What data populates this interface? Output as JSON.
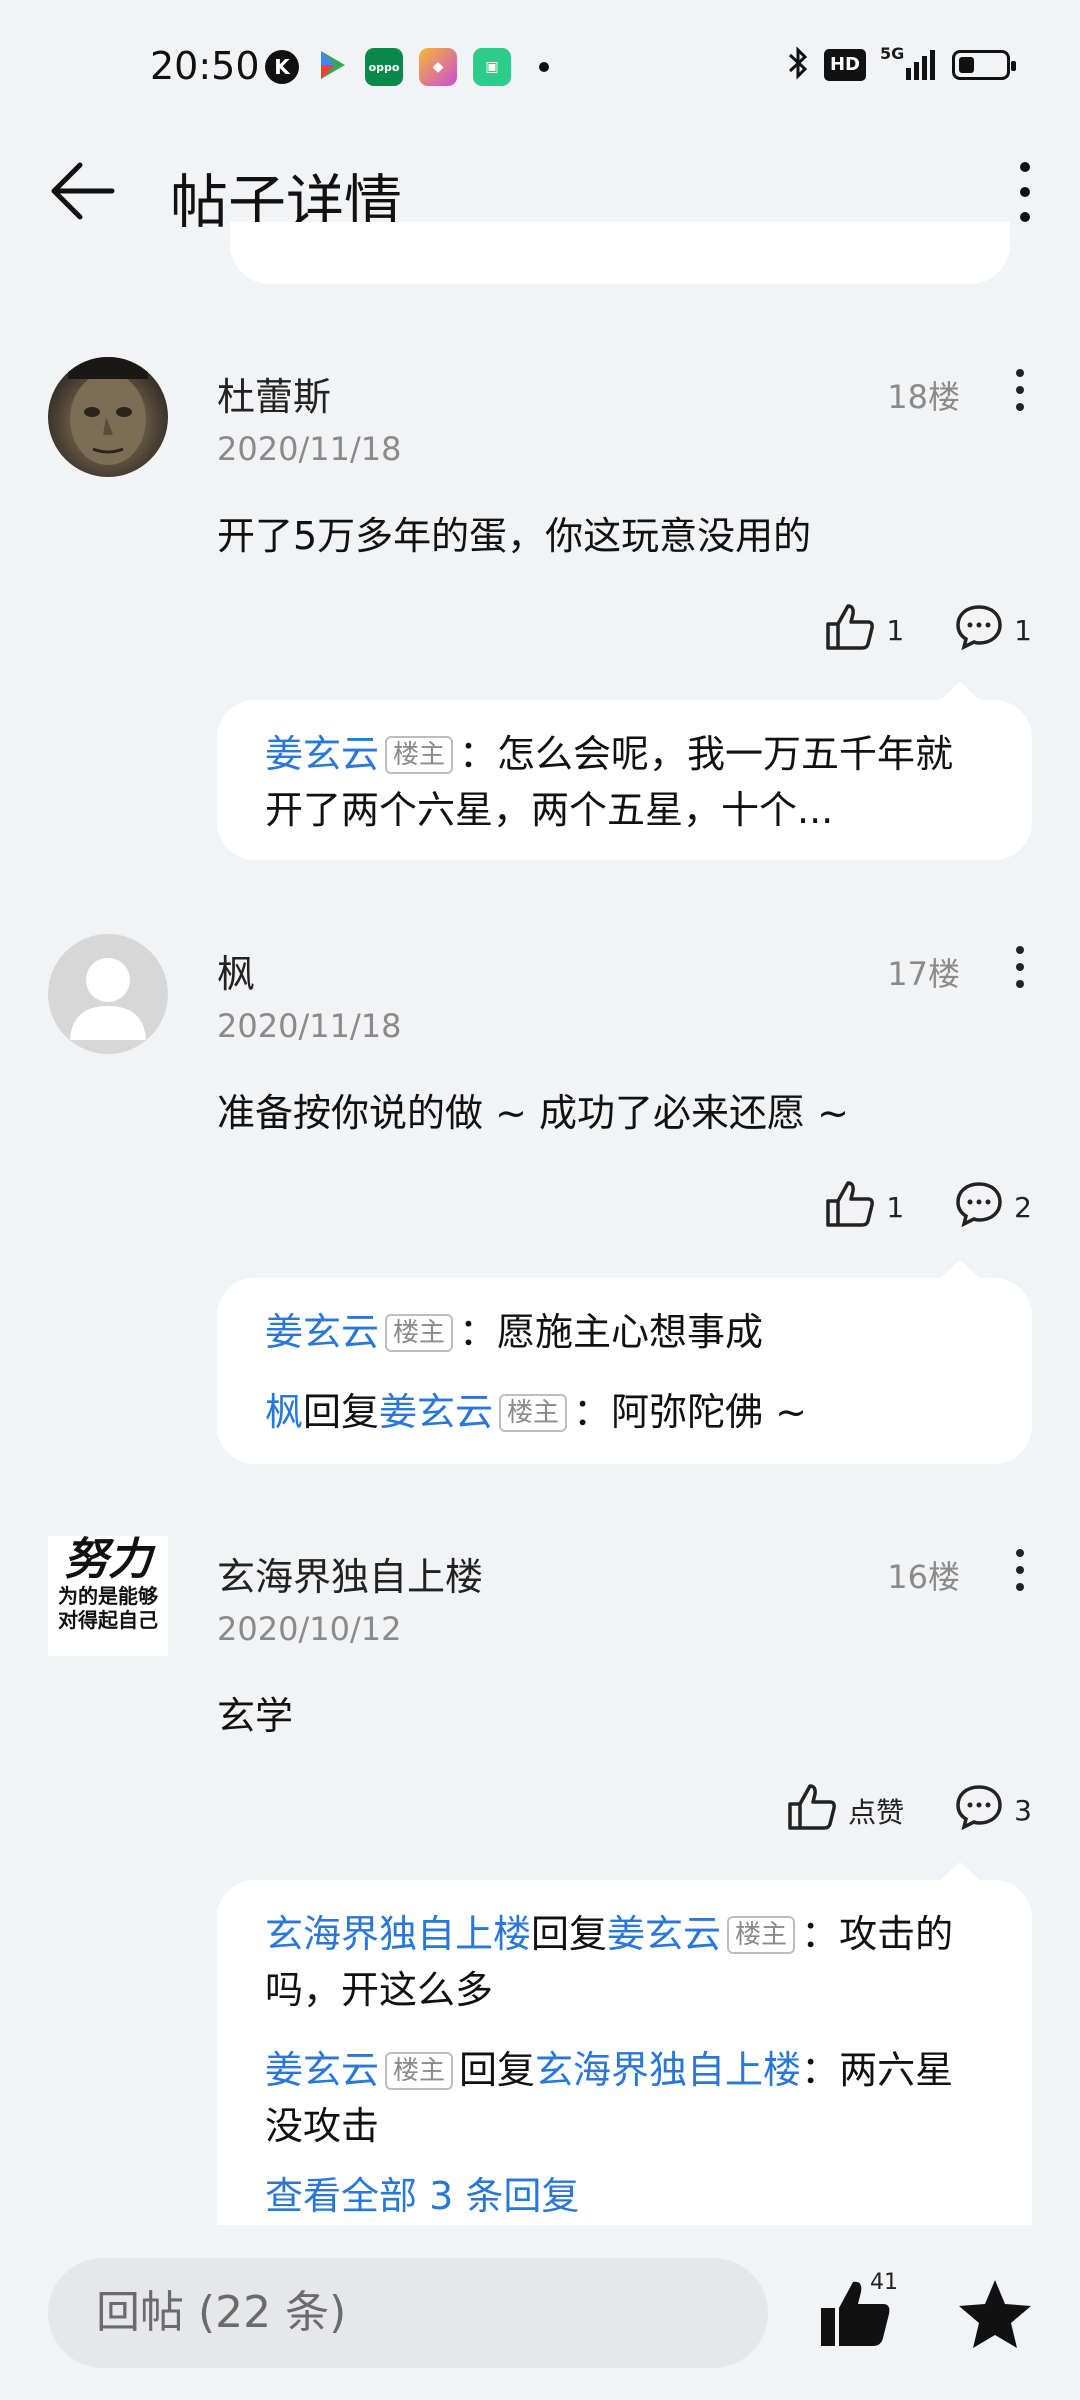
{
  "status_bar": {
    "time": "20:50",
    "network": "5G",
    "hd": "HD",
    "battery_level": 0.35
  },
  "header": {
    "title": "帖子详情"
  },
  "posts": [
    {
      "username": "杜蕾斯",
      "date": "2020/11/18",
      "floor": "18楼",
      "content": "开了5万多年的蛋，你这玩意没用的",
      "likes": "1",
      "comments": "1",
      "replies": [
        {
          "from": "姜玄云",
          "badge": "楼主",
          "sep": "：",
          "text": "怎么会呢，我一万五千年就开了两个六星，两个五星，十个..."
        }
      ]
    },
    {
      "username": "枫",
      "date": "2020/11/18",
      "floor": "17楼",
      "content": "准备按你说的做 ~ 成功了必来还愿 ~",
      "likes": "1",
      "comments": "2",
      "replies": [
        {
          "from": "姜玄云",
          "badge": "楼主",
          "sep": "：",
          "text": "愿施主心想事成"
        },
        {
          "from": "枫",
          "reply_word": "回复",
          "to": "姜玄云",
          "badge": "楼主",
          "sep": "：",
          "text": "阿弥陀佛 ~"
        }
      ]
    },
    {
      "username": "玄海界独自上楼",
      "date": "2020/10/12",
      "floor": "16楼",
      "content": "玄学",
      "likes": "点赞",
      "comments": "3",
      "avatar_text": [
        "努力",
        "为的是能够",
        "对得起自己"
      ],
      "replies": [
        {
          "from": "玄海界独自上楼",
          "reply_word": "回复",
          "to": "姜玄云",
          "badge": "楼主",
          "sep": "：",
          "text": "攻击的吗，开这么多"
        },
        {
          "from": "姜玄云",
          "badge": "楼主",
          "reply_word": "回复",
          "to": "玄海界独自上楼",
          "sep": "：",
          "text": "两六星没攻击"
        }
      ],
      "view_all": "查看全部 3 条回复"
    }
  ],
  "bottom_bar": {
    "reply_placeholder": "回帖 (22 条)",
    "like_count": "41"
  },
  "colors": {
    "link_blue": "#2977d9",
    "background": "#f1f3f5"
  }
}
